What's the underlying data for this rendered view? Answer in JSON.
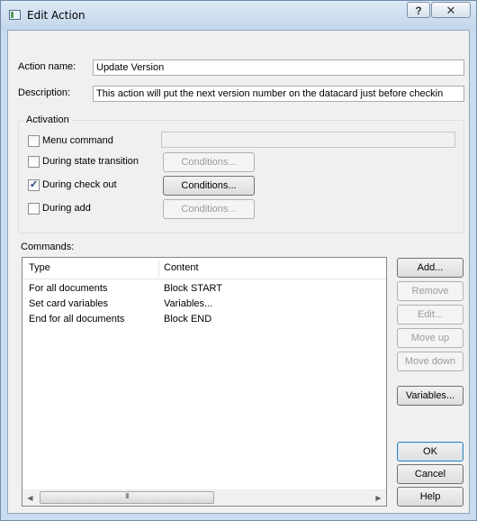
{
  "window": {
    "title": "Edit Action",
    "help_glyph": "?",
    "close_glyph": "✕"
  },
  "form": {
    "action_name_label": "Action name:",
    "action_name_value": "Update Version",
    "description_label": "Description:",
    "description_value": "This action will put the next version number on the datacard just before checkin"
  },
  "activation": {
    "group_label": "Activation",
    "menu_command": {
      "label": "Menu command",
      "checked": false,
      "value": ""
    },
    "during_state_transition": {
      "label": "During state transition",
      "checked": false,
      "button": "Conditions...",
      "button_enabled": false
    },
    "during_check_out": {
      "label": "During check out",
      "checked": true,
      "button": "Conditions...",
      "button_enabled": true
    },
    "during_add": {
      "label": "During add",
      "checked": false,
      "button": "Conditions...",
      "button_enabled": false
    }
  },
  "commands": {
    "label": "Commands:",
    "columns": [
      "Type",
      "Content"
    ],
    "rows": [
      {
        "type": "For all documents",
        "content": "Block START"
      },
      {
        "type": "Set card variables",
        "content": "Variables..."
      },
      {
        "type": "End for all documents",
        "content": "Block END"
      }
    ],
    "scroll_left": "◀",
    "scroll_right": "▶",
    "thumb_grip": "III"
  },
  "buttons": {
    "add": "Add...",
    "remove": "Remove",
    "edit": "Edit...",
    "move_up": "Move up",
    "move_down": "Move down",
    "variables": "Variables...",
    "ok": "OK",
    "cancel": "Cancel",
    "help": "Help"
  },
  "colors": {
    "frame": "#c9dbee",
    "client": "#f0f0f0",
    "check_mark": "#1c3d7a",
    "default_button_border": "#3c7fb1"
  }
}
